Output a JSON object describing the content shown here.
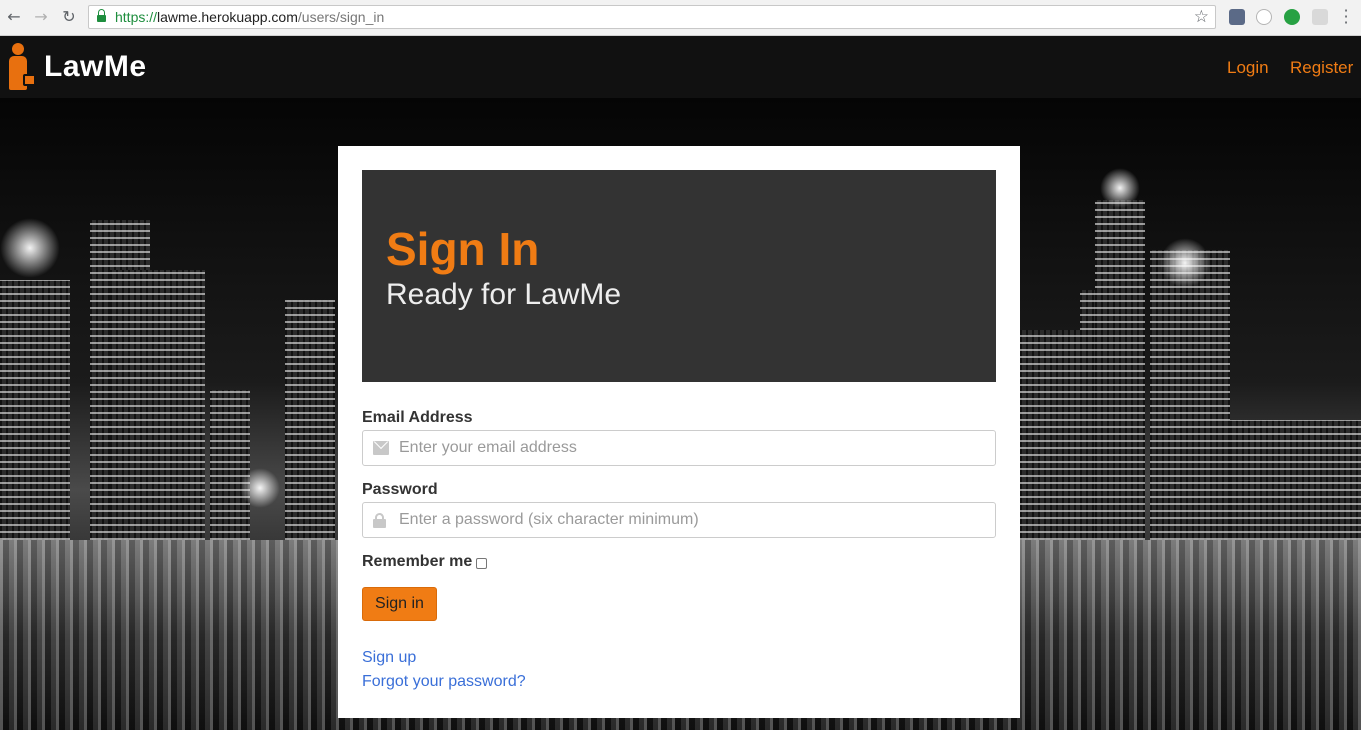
{
  "browser": {
    "url_scheme": "https://",
    "url_host": "lawme.herokuapp.com",
    "url_path": "/users/sign_in",
    "back_icon": "arrow-left-icon",
    "forward_icon": "arrow-right-icon",
    "reload_icon": "reload-icon",
    "secure_icon": "lock-icon",
    "bookmark_icon": "star-icon",
    "menu_icon": "kebab-menu-icon"
  },
  "navbar": {
    "brand": "LawMe",
    "logo_icon": "lawyer-briefcase-icon",
    "links": {
      "login": "Login",
      "register": "Register"
    }
  },
  "hero": {
    "title": "Sign In",
    "subtitle": "Ready for LawMe"
  },
  "form": {
    "email_label": "Email Address",
    "email_placeholder": "Enter your email address",
    "email_value": "",
    "password_label": "Password",
    "password_placeholder": "Enter a password (six character minimum)",
    "password_value": "",
    "remember_label": "Remember me",
    "remember_checked": false,
    "submit_label": "Sign in"
  },
  "links": {
    "signup": "Sign up",
    "forgot": "Forgot your password?"
  },
  "colors": {
    "accent": "#f07c14",
    "hero_bg": "#333333",
    "link": "#3a6fd8",
    "navbar_bg": "#111111"
  }
}
